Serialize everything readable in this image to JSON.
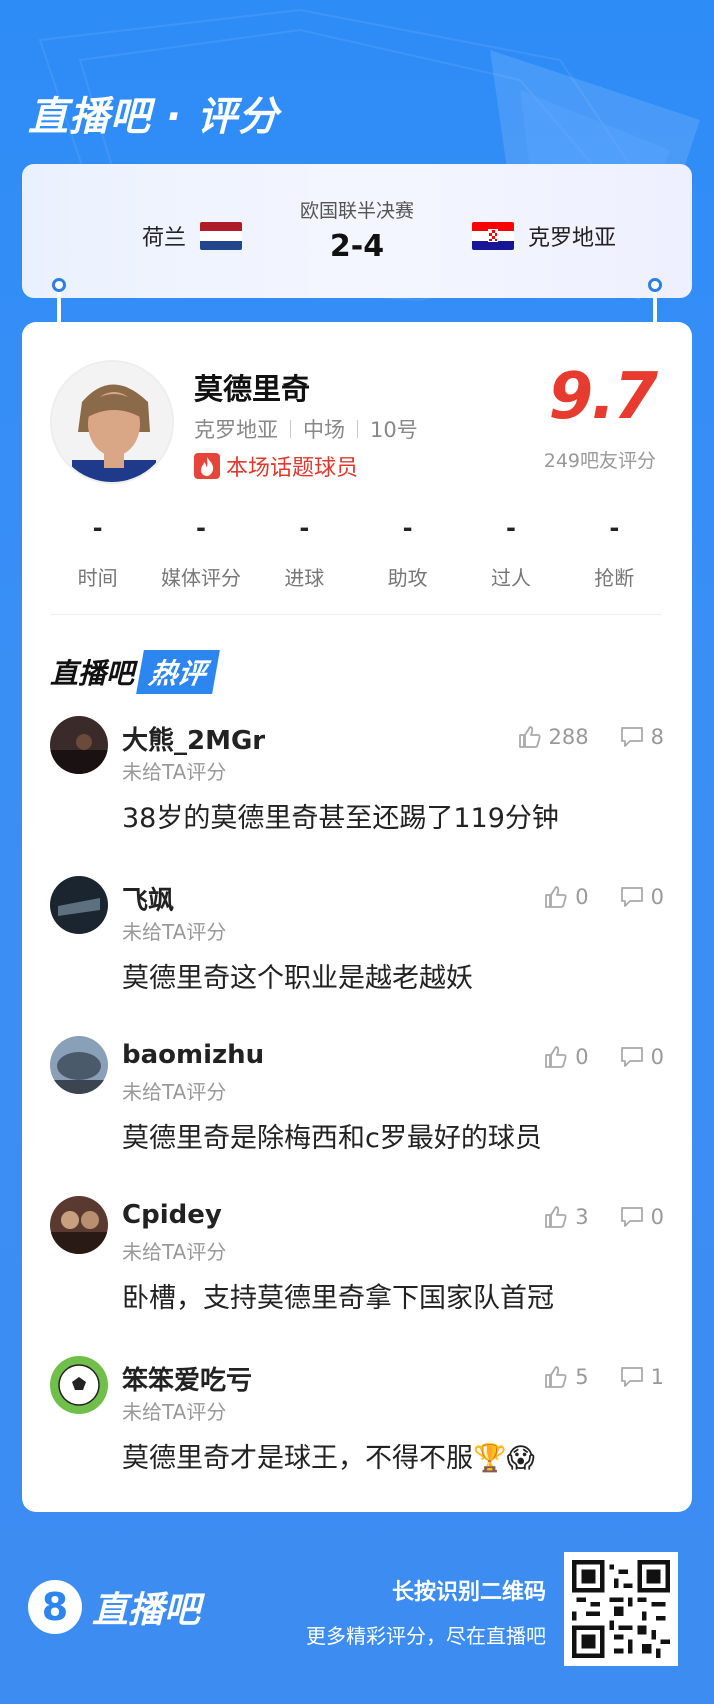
{
  "header": {
    "title": "直播吧 · 评分"
  },
  "match": {
    "home_team": "荷兰",
    "away_team": "克罗地亚",
    "league": "欧国联半决赛",
    "score": "2-4"
  },
  "player": {
    "name": "莫德里奇",
    "team": "克罗地亚",
    "position": "中场",
    "number": "10号",
    "tag": "本场话题球员",
    "rating": "9.7",
    "rating_count": "249吧友评分",
    "stats": [
      {
        "value": "-",
        "label": "时间"
      },
      {
        "value": "-",
        "label": "媒体评分"
      },
      {
        "value": "-",
        "label": "进球"
      },
      {
        "value": "-",
        "label": "助攻"
      },
      {
        "value": "-",
        "label": "过人"
      },
      {
        "value": "-",
        "label": "抢断"
      }
    ]
  },
  "hot_section": {
    "prefix": "直播吧",
    "highlight": "热评"
  },
  "comments": [
    {
      "user": "大熊_2MGr",
      "sub": "未给TA评分",
      "text": "38岁的莫德里奇甚至还踢了119分钟",
      "likes": "288",
      "dislikes": "8"
    },
    {
      "user": "飞飒",
      "sub": "未给TA评分",
      "text": "莫德里奇这个职业是越老越妖",
      "likes": "0",
      "dislikes": "0"
    },
    {
      "user": "baomizhu",
      "sub": "未给TA评分",
      "text": "莫德里奇是除梅西和c罗最好的球员",
      "likes": "0",
      "dislikes": "0"
    },
    {
      "user": "Cpidey",
      "sub": "未给TA评分",
      "text": "卧槽，支持莫德里奇拿下国家队首冠",
      "likes": "3",
      "dislikes": "0"
    },
    {
      "user": "笨笨爱吃亏",
      "sub": "未给TA评分",
      "text": "莫德里奇才是球王，不得不服🏆😱",
      "likes": "5",
      "dislikes": "1"
    }
  ],
  "footer": {
    "logo_mark": "8",
    "logo_text": "直播吧",
    "line1": "长按识别二维码",
    "line2": "更多精彩评分，尽在直播吧"
  },
  "colors": {
    "brand_blue": "#2d86f0",
    "rating_red": "#e73b2f"
  }
}
